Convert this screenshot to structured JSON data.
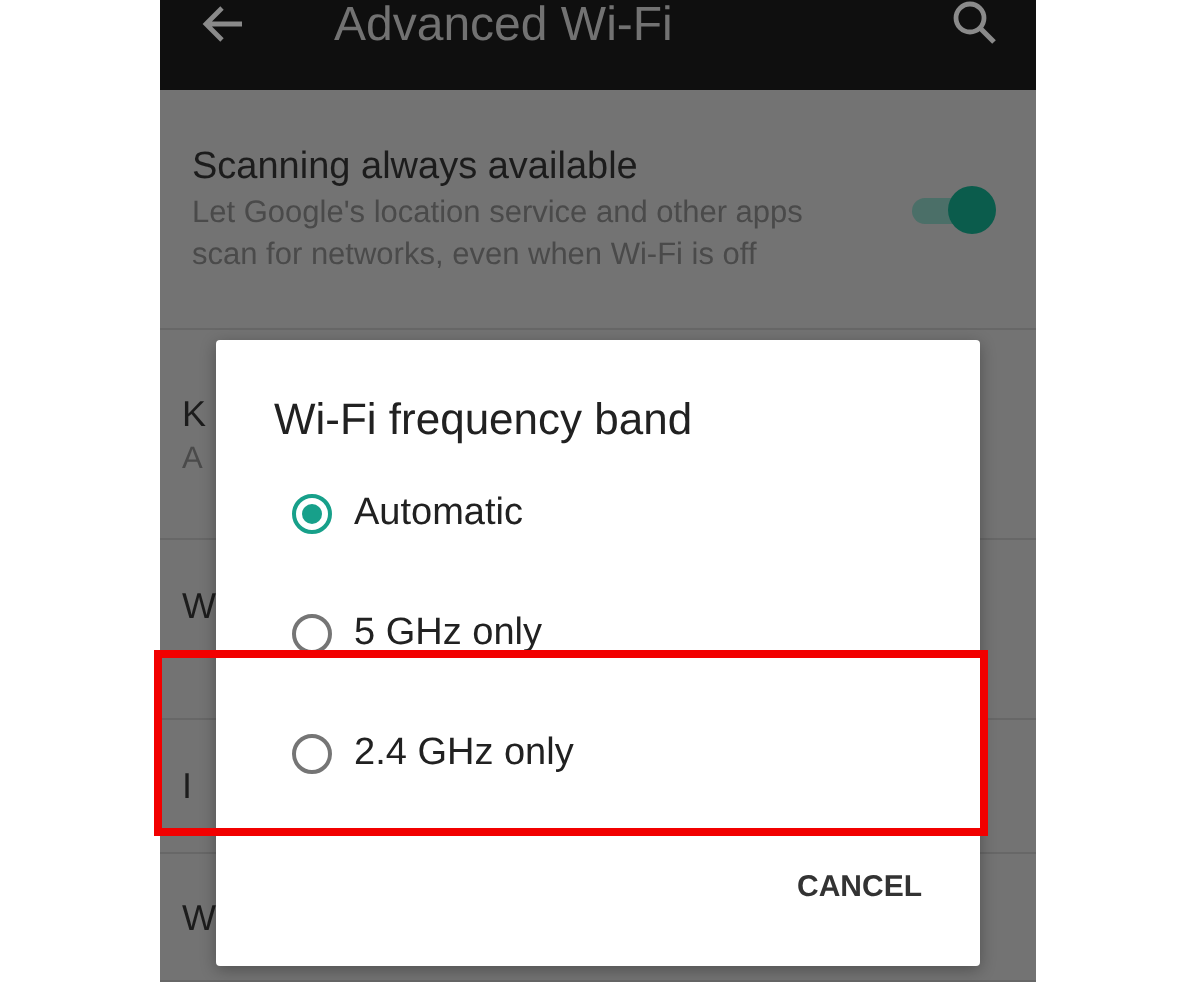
{
  "toolbar": {
    "title": "Advanced Wi-Fi"
  },
  "settings": [
    {
      "title": "Scanning always available",
      "summary": "Let Google's location service and other apps scan for networks, even when Wi-Fi is off",
      "on": true
    },
    {
      "title": "K",
      "summary": "A"
    },
    {
      "title": "W"
    },
    {
      "title": "I"
    },
    {
      "title": "W"
    }
  ],
  "dialog": {
    "title": "Wi-Fi frequency band",
    "options": [
      {
        "label": "Automatic",
        "selected": true,
        "highlighted": false
      },
      {
        "label": "5 GHz only",
        "selected": false,
        "highlighted": false
      },
      {
        "label": "2.4 GHz only",
        "selected": false,
        "highlighted": true
      }
    ],
    "buttons": [
      "CANCEL"
    ]
  }
}
